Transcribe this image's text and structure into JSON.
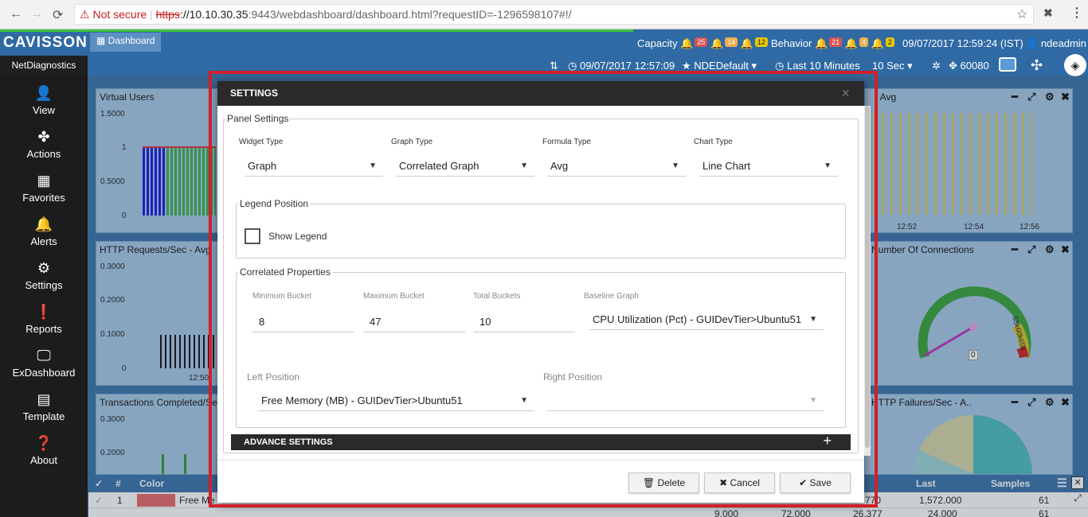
{
  "browser": {
    "security_label": "Not secure",
    "url_scheme": "https",
    "url_host": "://10.10.30.35",
    "url_path": ":9443/webdashboard/dashboard.html?requestID=-1296598107#!/"
  },
  "app": {
    "logo": "CAVISSON",
    "dashboard_tab": "Dashboard",
    "product": "NetDiagnostics",
    "capacity_label": "Capacity",
    "capacity_badges": [
      "25",
      "14",
      "12"
    ],
    "behavior_label": "Behavior",
    "behavior_badges": [
      "21",
      "4",
      "2"
    ],
    "datetime": "09/07/2017 12:59:24 (IST)",
    "user": "ndeadmin",
    "start_time": "09/07/2017 12:57:09",
    "profile": "NDEDefault",
    "time_range": "Last 10 Minutes",
    "interval": "10 Sec",
    "port": "60080"
  },
  "sidebar": {
    "items": [
      {
        "label": "View"
      },
      {
        "label": "Actions"
      },
      {
        "label": "Favorites"
      },
      {
        "label": "Alerts"
      },
      {
        "label": "Settings"
      },
      {
        "label": "Reports"
      },
      {
        "label": "ExDashboard"
      },
      {
        "label": "Template"
      },
      {
        "label": "About"
      }
    ]
  },
  "panels": {
    "virtual_users": {
      "title": "Virtual Users",
      "y": [
        "1.5000",
        "1",
        "0.5000",
        "0"
      ]
    },
    "http_requests": {
      "title": "HTTP Requests/Sec - Avg",
      "y": [
        "0.3000",
        "0.2000",
        "0.1000",
        "0"
      ],
      "x": "12:50"
    },
    "transactions": {
      "title": "Transactions Completed/Se",
      "y": [
        "0.3000",
        "0.2000"
      ]
    },
    "right_top": {
      "title": "- Avg",
      "x": [
        "12:52",
        "12:54",
        "12:56"
      ]
    },
    "connections": {
      "title": "Number Of Connections",
      "gauge_value": "0",
      "gauge_max": "55k60k65k"
    },
    "failures": {
      "title": "HTTP Failures/Sec - A.."
    }
  },
  "modal": {
    "title": "SETTINGS",
    "panel_settings_legend": "Panel Settings",
    "widget_type_label": "Widget Type",
    "widget_type_value": "Graph",
    "graph_type_label": "Graph Type",
    "graph_type_value": "Correlated Graph",
    "formula_type_label": "Formula Type",
    "formula_type_value": "Avg",
    "chart_type_label": "Chart Type",
    "chart_type_value": "Line Chart",
    "legend_position_legend": "Legend Position",
    "show_legend_label": "Show Legend",
    "correlated_legend": "Correlated Properties",
    "min_bucket_label": "Minimum Bucket",
    "min_bucket_value": "8",
    "max_bucket_label": "Maximum Bucket",
    "max_bucket_value": "47",
    "total_buckets_label": "Total Buckets",
    "total_buckets_value": "10",
    "baseline_label": "Baseline Graph",
    "baseline_value": "CPU Utilization (Pct) - GUIDevTier>Ubuntu51",
    "left_position_label": "Left Position",
    "left_position_value": "Free Memory (MB) - GUIDevTier>Ubuntu51",
    "right_position_label": "Right Position",
    "right_position_value": "",
    "advance_settings": "ADVANCE SETTINGS",
    "delete_label": "Delete",
    "cancel_label": "Cancel",
    "save_label": "Save"
  },
  "table": {
    "headers": {
      "sel": "✓",
      "num": "#",
      "color": "Color",
      "last": "Last",
      "samples": "Samples"
    },
    "rows": [
      {
        "num": "1",
        "name": "Free Me",
        "last": "1,572.000",
        "samples": "61"
      },
      {
        "num": "",
        "name": "",
        "last": "24.000",
        "samples": "61"
      }
    ],
    "row2_extra": [
      "9.000",
      "72.000",
      "26.377"
    ],
    "row1_partial": "770"
  },
  "colors": {
    "accent": "#2f6aa5",
    "highlight": "#d0202a",
    "dark": "#2a2a2a"
  }
}
